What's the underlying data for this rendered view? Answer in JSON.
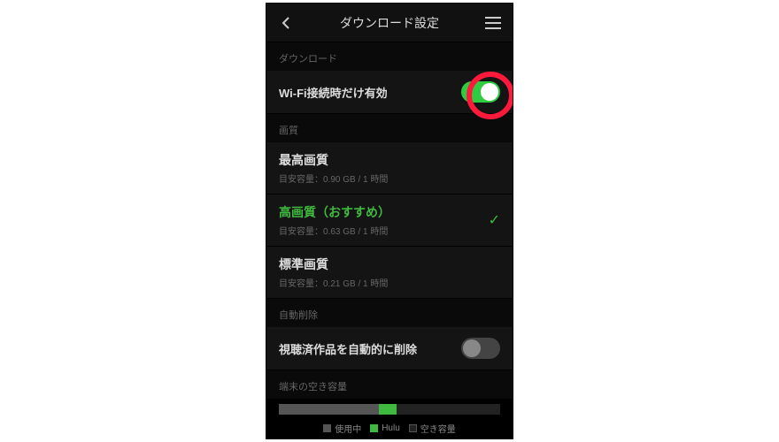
{
  "header": {
    "title": "ダウンロード設定"
  },
  "sections": {
    "download": {
      "label": "ダウンロード",
      "wifi_only": "Wi-Fi接続時だけ有効",
      "toggle_on": true
    },
    "quality": {
      "label": "画質",
      "options": [
        {
          "title": "最高画質",
          "sub": "目安容量：0.90 GB / 1 時間",
          "selected": false
        },
        {
          "title": "高画質（おすすめ）",
          "sub": "目安容量：0.63 GB / 1 時間",
          "selected": true
        },
        {
          "title": "標準画質",
          "sub": "目安容量：0.21 GB / 1 時間",
          "selected": false
        }
      ]
    },
    "autodelete": {
      "label": "自動削除",
      "row": "視聴済作品を自動的に削除",
      "toggle_on": false
    },
    "storage": {
      "label": "端末の空き容量",
      "legend": {
        "used": "使用中",
        "hulu": "Hulu",
        "free": "空き容量"
      },
      "bar": {
        "used_pct": 45,
        "hulu_pct": 8,
        "free_pct": 47
      }
    }
  }
}
